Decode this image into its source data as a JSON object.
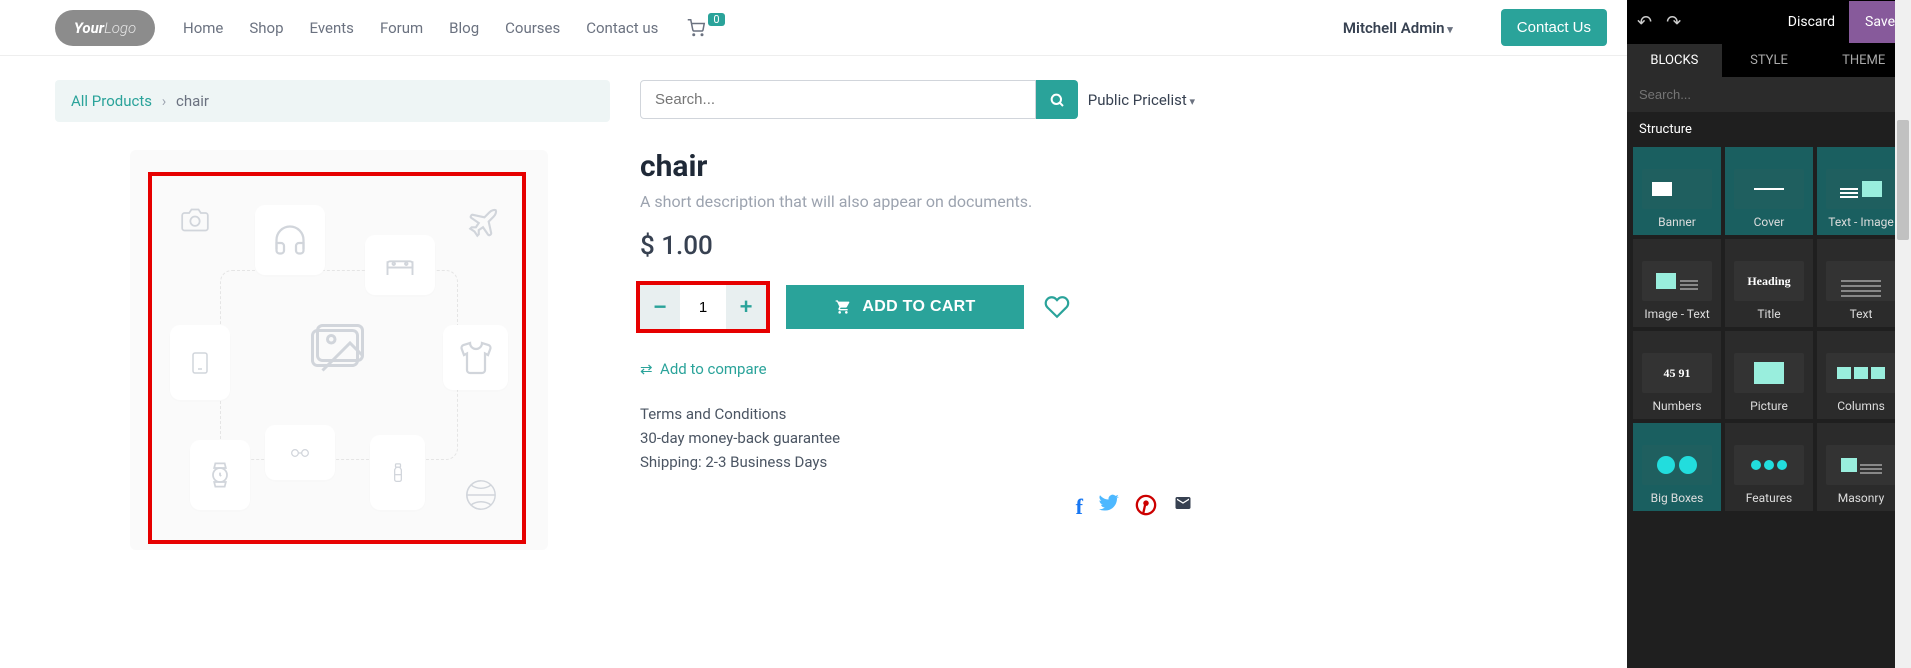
{
  "header": {
    "logo_text1": "Your",
    "logo_text2": "Logo",
    "nav": [
      "Home",
      "Shop",
      "Events",
      "Forum",
      "Blog",
      "Courses",
      "Contact us"
    ],
    "cart_count": "0",
    "user": "Mitchell Admin",
    "contact_btn": "Contact Us"
  },
  "breadcrumb": {
    "root": "All Products",
    "current": "chair"
  },
  "search": {
    "placeholder": "Search...",
    "pricelist": "Public Pricelist"
  },
  "product": {
    "title": "chair",
    "desc": "A short description that will also appear on documents.",
    "price": "$ 1.00",
    "qty": "1",
    "add_btn": "ADD TO CART",
    "compare": "Add to compare",
    "terms_line1": "Terms and Conditions",
    "terms_line2": "30-day money-back guarantee",
    "terms_line3": "Shipping: 2-3 Business Days"
  },
  "editor": {
    "discard": "Discard",
    "save": "Save",
    "tabs": [
      "BLOCKS",
      "STYLE",
      "THEME"
    ],
    "search_placeholder": "Search...",
    "section": "Structure",
    "blocks": [
      "Banner",
      "Cover",
      "Text - Image",
      "Image - Text",
      "Title",
      "Text",
      "Numbers",
      "Picture",
      "Columns",
      "Big Boxes",
      "Features",
      "Masonry"
    ]
  }
}
